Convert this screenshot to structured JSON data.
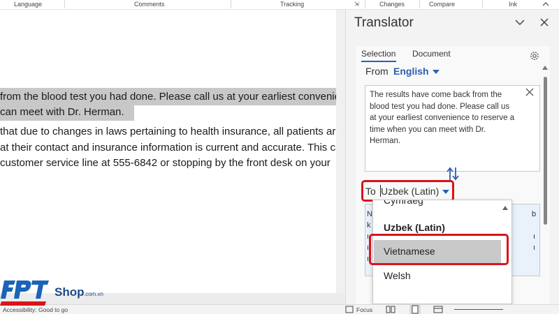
{
  "ribbon": {
    "groups": [
      "Language",
      "Comments",
      "Tracking",
      "Changes",
      "Compare",
      "Ink"
    ]
  },
  "document": {
    "lines": [
      "from the blood test you had done. Please call us at your earliest convenienc",
      "can meet with Dr. Herman.",
      " that due to changes in laws pertaining to health insurance, all patients are",
      "at their contact and insurance information is current and accurate. This can",
      " customer service line at 555-6842 or stopping by the front desk on your"
    ]
  },
  "translator": {
    "title": "Translator",
    "tabs": [
      "Selection",
      "Document"
    ],
    "from_label": "From",
    "from_language": "English",
    "source_text": "The results have come back from the blood test you had done. Please call us at your earliest convenience to reserve a time when you can meet with Dr. Herman.",
    "to_label": "To",
    "to_language": "Uzbek (Latin)",
    "output_fragments": [
      "N",
      "k",
      "b"
    ]
  },
  "dropdown": {
    "options": [
      "Cymraeg",
      "Uzbek (Latin)",
      "Vietnamese",
      "Welsh"
    ],
    "highlighted": "Vietnamese"
  },
  "status_bar": {
    "accessibility": "Accessibility: Good to go",
    "focus": "Focus"
  },
  "watermark": {
    "brand": "FPT",
    "suffix": "Shop",
    "domain": ".com.vn"
  },
  "colors": {
    "accent_blue": "#2b5fb4",
    "highlight_red": "#d9141a",
    "selection_gray": "#c8c8c8"
  }
}
